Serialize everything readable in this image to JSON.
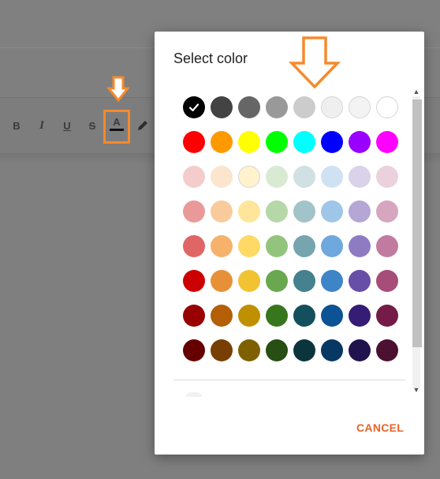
{
  "toolbar": {
    "bold_label": "B",
    "italic_label": "I",
    "underline_label": "U",
    "strike_label": "S",
    "text_color_label": "A"
  },
  "dialog": {
    "title": "Select color",
    "cancel_label": "CANCEL",
    "selected_index": 0,
    "palette": [
      [
        "#000000",
        "#434343",
        "#666666",
        "#999999",
        "#cccccc",
        "#efefef",
        "#f3f3f3",
        "#ffffff"
      ],
      [
        "#ff0000",
        "#ff9900",
        "#ffff00",
        "#00ff00",
        "#00ffff",
        "#0000ff",
        "#9900ff",
        "#ff00ff"
      ],
      [
        "#f4cccc",
        "#fce5cd",
        "#fff2cc",
        "#d9ead3",
        "#d0e0e3",
        "#cfe2f3",
        "#d9d2e9",
        "#ead1dc"
      ],
      [
        "#ea9999",
        "#f9cb9c",
        "#ffe599",
        "#b6d7a8",
        "#a2c4c9",
        "#9fc5e8",
        "#b4a7d6",
        "#d5a6bd"
      ],
      [
        "#e06666",
        "#f6b26b",
        "#ffd966",
        "#93c47d",
        "#76a5af",
        "#6fa8dc",
        "#8e7cc3",
        "#c27ba0"
      ],
      [
        "#cc0000",
        "#e69138",
        "#f1c232",
        "#6aa84f",
        "#45818e",
        "#3d85c6",
        "#674ea7",
        "#a64d79"
      ],
      [
        "#990000",
        "#b45f06",
        "#bf9000",
        "#38761d",
        "#134f5c",
        "#0b5394",
        "#351c75",
        "#741b47"
      ],
      [
        "#660000",
        "#783f04",
        "#7f6000",
        "#274e13",
        "#0c343d",
        "#073763",
        "#20124d",
        "#4c1130"
      ]
    ]
  },
  "colors": {
    "accent": "#e8642a",
    "highlight_orange": "#f58a2b"
  }
}
